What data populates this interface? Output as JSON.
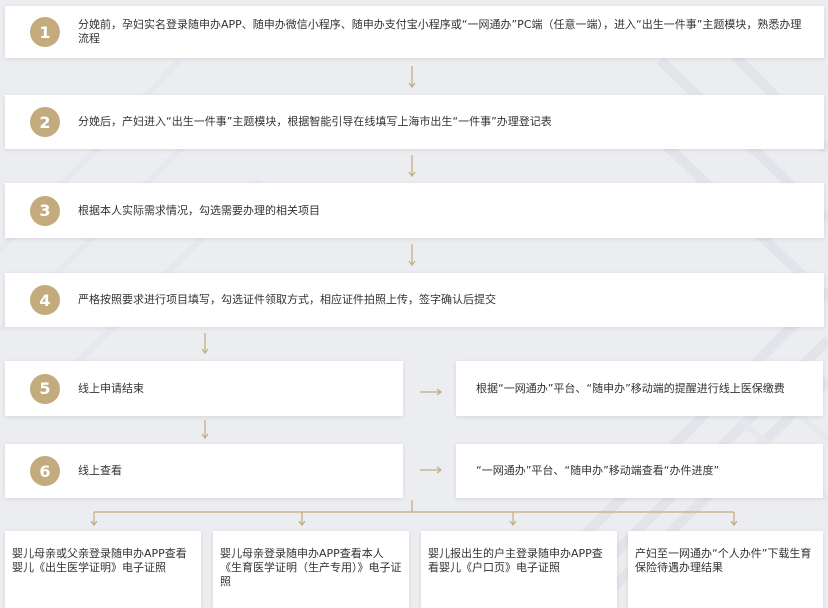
{
  "colors": {
    "accent": "#c3ab7d",
    "box": "#ffffff",
    "background": "#ecedf1",
    "text": "#333333"
  },
  "steps": [
    {
      "num": "1",
      "text": "分娩前，孕妇实名登录随申办APP、随申办微信小程序、随申办支付宝小程序或“一网通办”PC端（任意一端），进入“出生一件事”主题模块，熟悉办理流程"
    },
    {
      "num": "2",
      "text": "分娩后，产妇进入“出生一件事”主题模块，根据智能引导在线填写上海市出生“一件事”办理登记表"
    },
    {
      "num": "3",
      "text": "根据本人实际需求情况，勾选需要办理的相关项目"
    },
    {
      "num": "4",
      "text": "严格按照要求进行项目填写，勾选证件领取方式，相应证件拍照上传，签字确认后提交"
    },
    {
      "num": "5",
      "text": "线上申请结束"
    },
    {
      "num": "6",
      "text": "线上查看"
    }
  ],
  "side_notes": [
    {
      "text": "根据“一网通办”平台、“随申办”移动端的提醒进行线上医保缴费"
    },
    {
      "text": "“一网通办”平台、“随申办”移动端查看“办件进度”"
    }
  ],
  "results": [
    {
      "text": "婴儿母亲或父亲登录随申办APP查看婴儿《出生医学证明》电子证照"
    },
    {
      "text": "婴儿母亲登录随申办APP查看本人《生育医学证明（生产专用）》电子证照"
    },
    {
      "text": "婴儿报出生的户主登录随申办APP查看婴儿《户口页》电子证照"
    },
    {
      "text": "产妇至一网通办“个人办件”下载生育保险待遇办理结果"
    }
  ]
}
